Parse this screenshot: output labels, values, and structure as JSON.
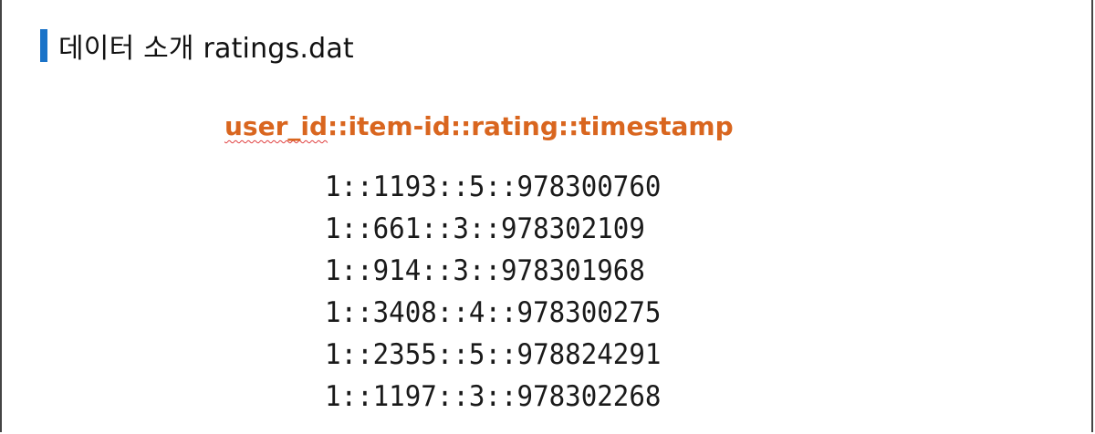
{
  "heading": {
    "text": "데이터 소개 ratings.dat",
    "marker_color": "#1a73c8"
  },
  "format_line": {
    "first_part": "user_id",
    "rest": "::item-id::rating::timestamp",
    "color": "#d9661f"
  },
  "records": [
    "1::1193::5::978300760",
    "1::661::3::978302109",
    "1::914::3::978301968",
    "1::3408::4::978300275",
    "1::2355::5::978824291",
    "1::1197::3::978302268"
  ]
}
